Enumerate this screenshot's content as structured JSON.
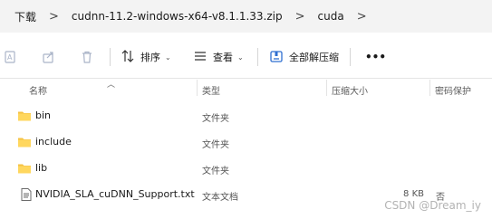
{
  "breadcrumb": {
    "items": [
      "下载",
      "cudnn-11.2-windows-x64-v8.1.1.33.zip",
      "cuda"
    ],
    "separator": ">"
  },
  "toolbar": {
    "sort_label": "排序",
    "view_label": "查看",
    "extract_label": "全部解压缩",
    "more_label": "•••",
    "caret": "⌄"
  },
  "columns": {
    "name": "名称",
    "type": "类型",
    "compressed_size": "压缩大小",
    "password_protected": "密码保护"
  },
  "files": [
    {
      "name": "bin",
      "type": "文件夹",
      "size": "",
      "protected": "",
      "icon": "folder-icon"
    },
    {
      "name": "include",
      "type": "文件夹",
      "size": "",
      "protected": "",
      "icon": "folder-icon"
    },
    {
      "name": "lib",
      "type": "文件夹",
      "size": "",
      "protected": "",
      "icon": "folder-icon"
    },
    {
      "name": "NVIDIA_SLA_cuDNN_Support.txt",
      "type": "文本文档",
      "size": "8 KB",
      "protected": "否",
      "icon": "text-file-icon"
    }
  ],
  "watermark": "CSDN @Dream_iy",
  "colors": {
    "folder": "#f5c244",
    "folder_dark": "#e3a92e",
    "extract_icon": "#2f6fd1",
    "breadcrumb_bg": "#f3f3f3"
  }
}
